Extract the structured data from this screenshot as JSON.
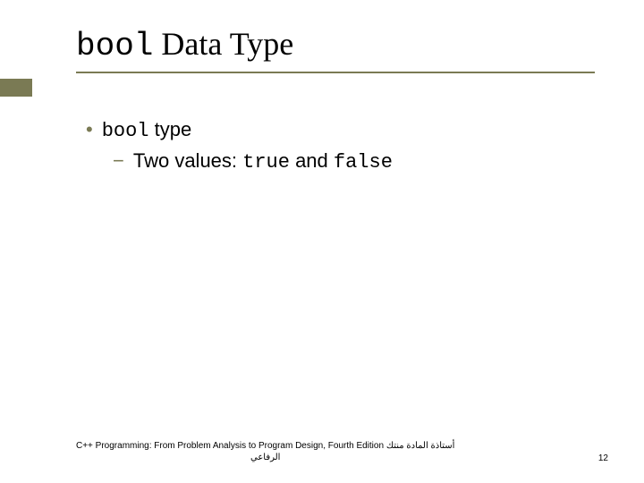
{
  "title": {
    "mono": "bool",
    "serif": " Data Type"
  },
  "bullets": {
    "main": {
      "mono": "bool",
      "rest": " type"
    },
    "sub": {
      "prefix": "Two values: ",
      "mono1": "true",
      "mid": " and ",
      "mono2": "false"
    }
  },
  "footer": {
    "book": "C++ Programming: From Problem Analysis to Program Design, Fourth Edition",
    "arabic1": "أستاذة المادة منتك",
    "arabic2": "الرفاعي"
  },
  "page": "12"
}
